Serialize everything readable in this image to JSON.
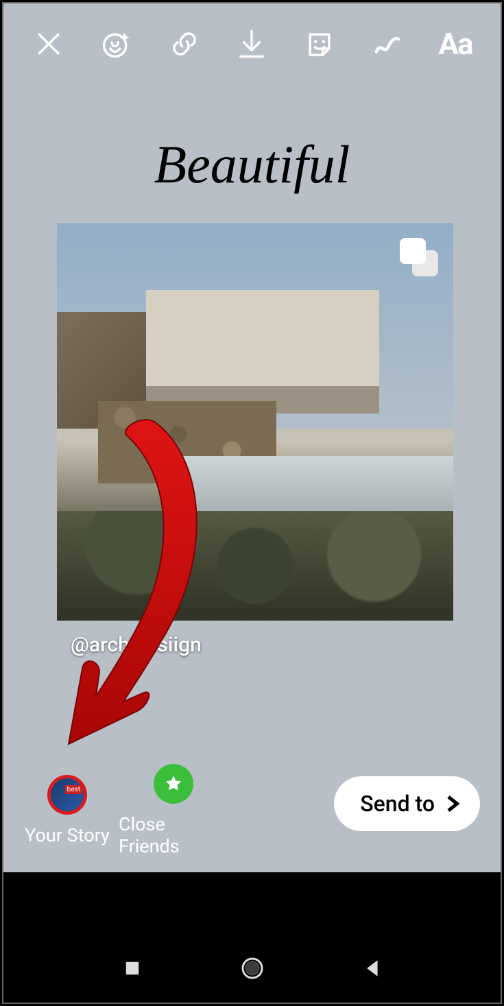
{
  "toolbar": {
    "close": "close",
    "effects": "effects",
    "link": "link",
    "download": "download",
    "sticker": "sticker",
    "draw": "draw",
    "text_label": "Aa"
  },
  "caption": "Beautiful",
  "post": {
    "handle": "@archidesiign",
    "multi_image": true
  },
  "share": {
    "your_story_label": "Your Story",
    "close_friends_label": "Close Friends",
    "send_to_label": "Send to"
  },
  "nav": {
    "recents": "recent-apps",
    "home": "home",
    "back": "back"
  },
  "annotation": {
    "arrow_color": "#cc0808",
    "target": "your-story-button"
  }
}
